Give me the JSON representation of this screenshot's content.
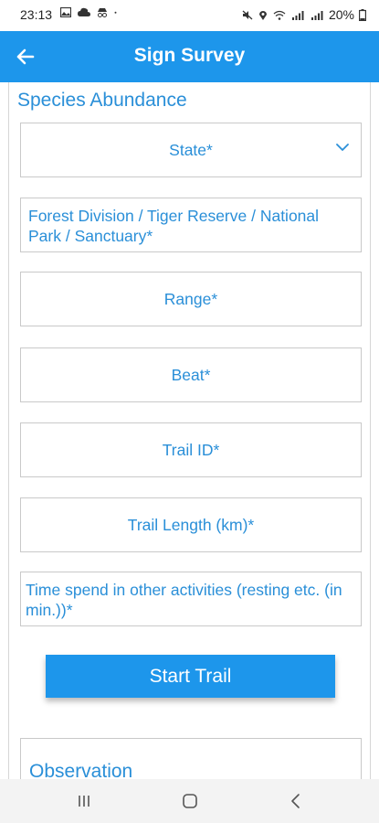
{
  "status_bar": {
    "time": "23:13",
    "battery": "20%",
    "icons_left": [
      "image-icon",
      "cloud-icon",
      "incognito-icon",
      "dot-icon"
    ],
    "icons_right": [
      "mute-icon",
      "location-icon",
      "wifi-icon",
      "signal-icon",
      "signal-icon"
    ]
  },
  "app_bar": {
    "title": "Sign Survey",
    "background": "#1d96eb"
  },
  "form": {
    "section_title": "Species Abundance",
    "fields": {
      "state": "State*",
      "forest_division": "Forest Division / Tiger Reserve / National Park / Sanctuary*",
      "range": "Range*",
      "beat": "Beat*",
      "trail_id": "Trail ID*",
      "trail_length": "Trail Length (km)*",
      "time_spend": "Time spend in other activities (resting etc. (in min.))*"
    },
    "start_button": "Start Trail",
    "observation_title": "Observation"
  },
  "colors": {
    "accent": "#1d96eb",
    "text_blue": "#2a8fd8",
    "border": "#c9c9c9"
  }
}
